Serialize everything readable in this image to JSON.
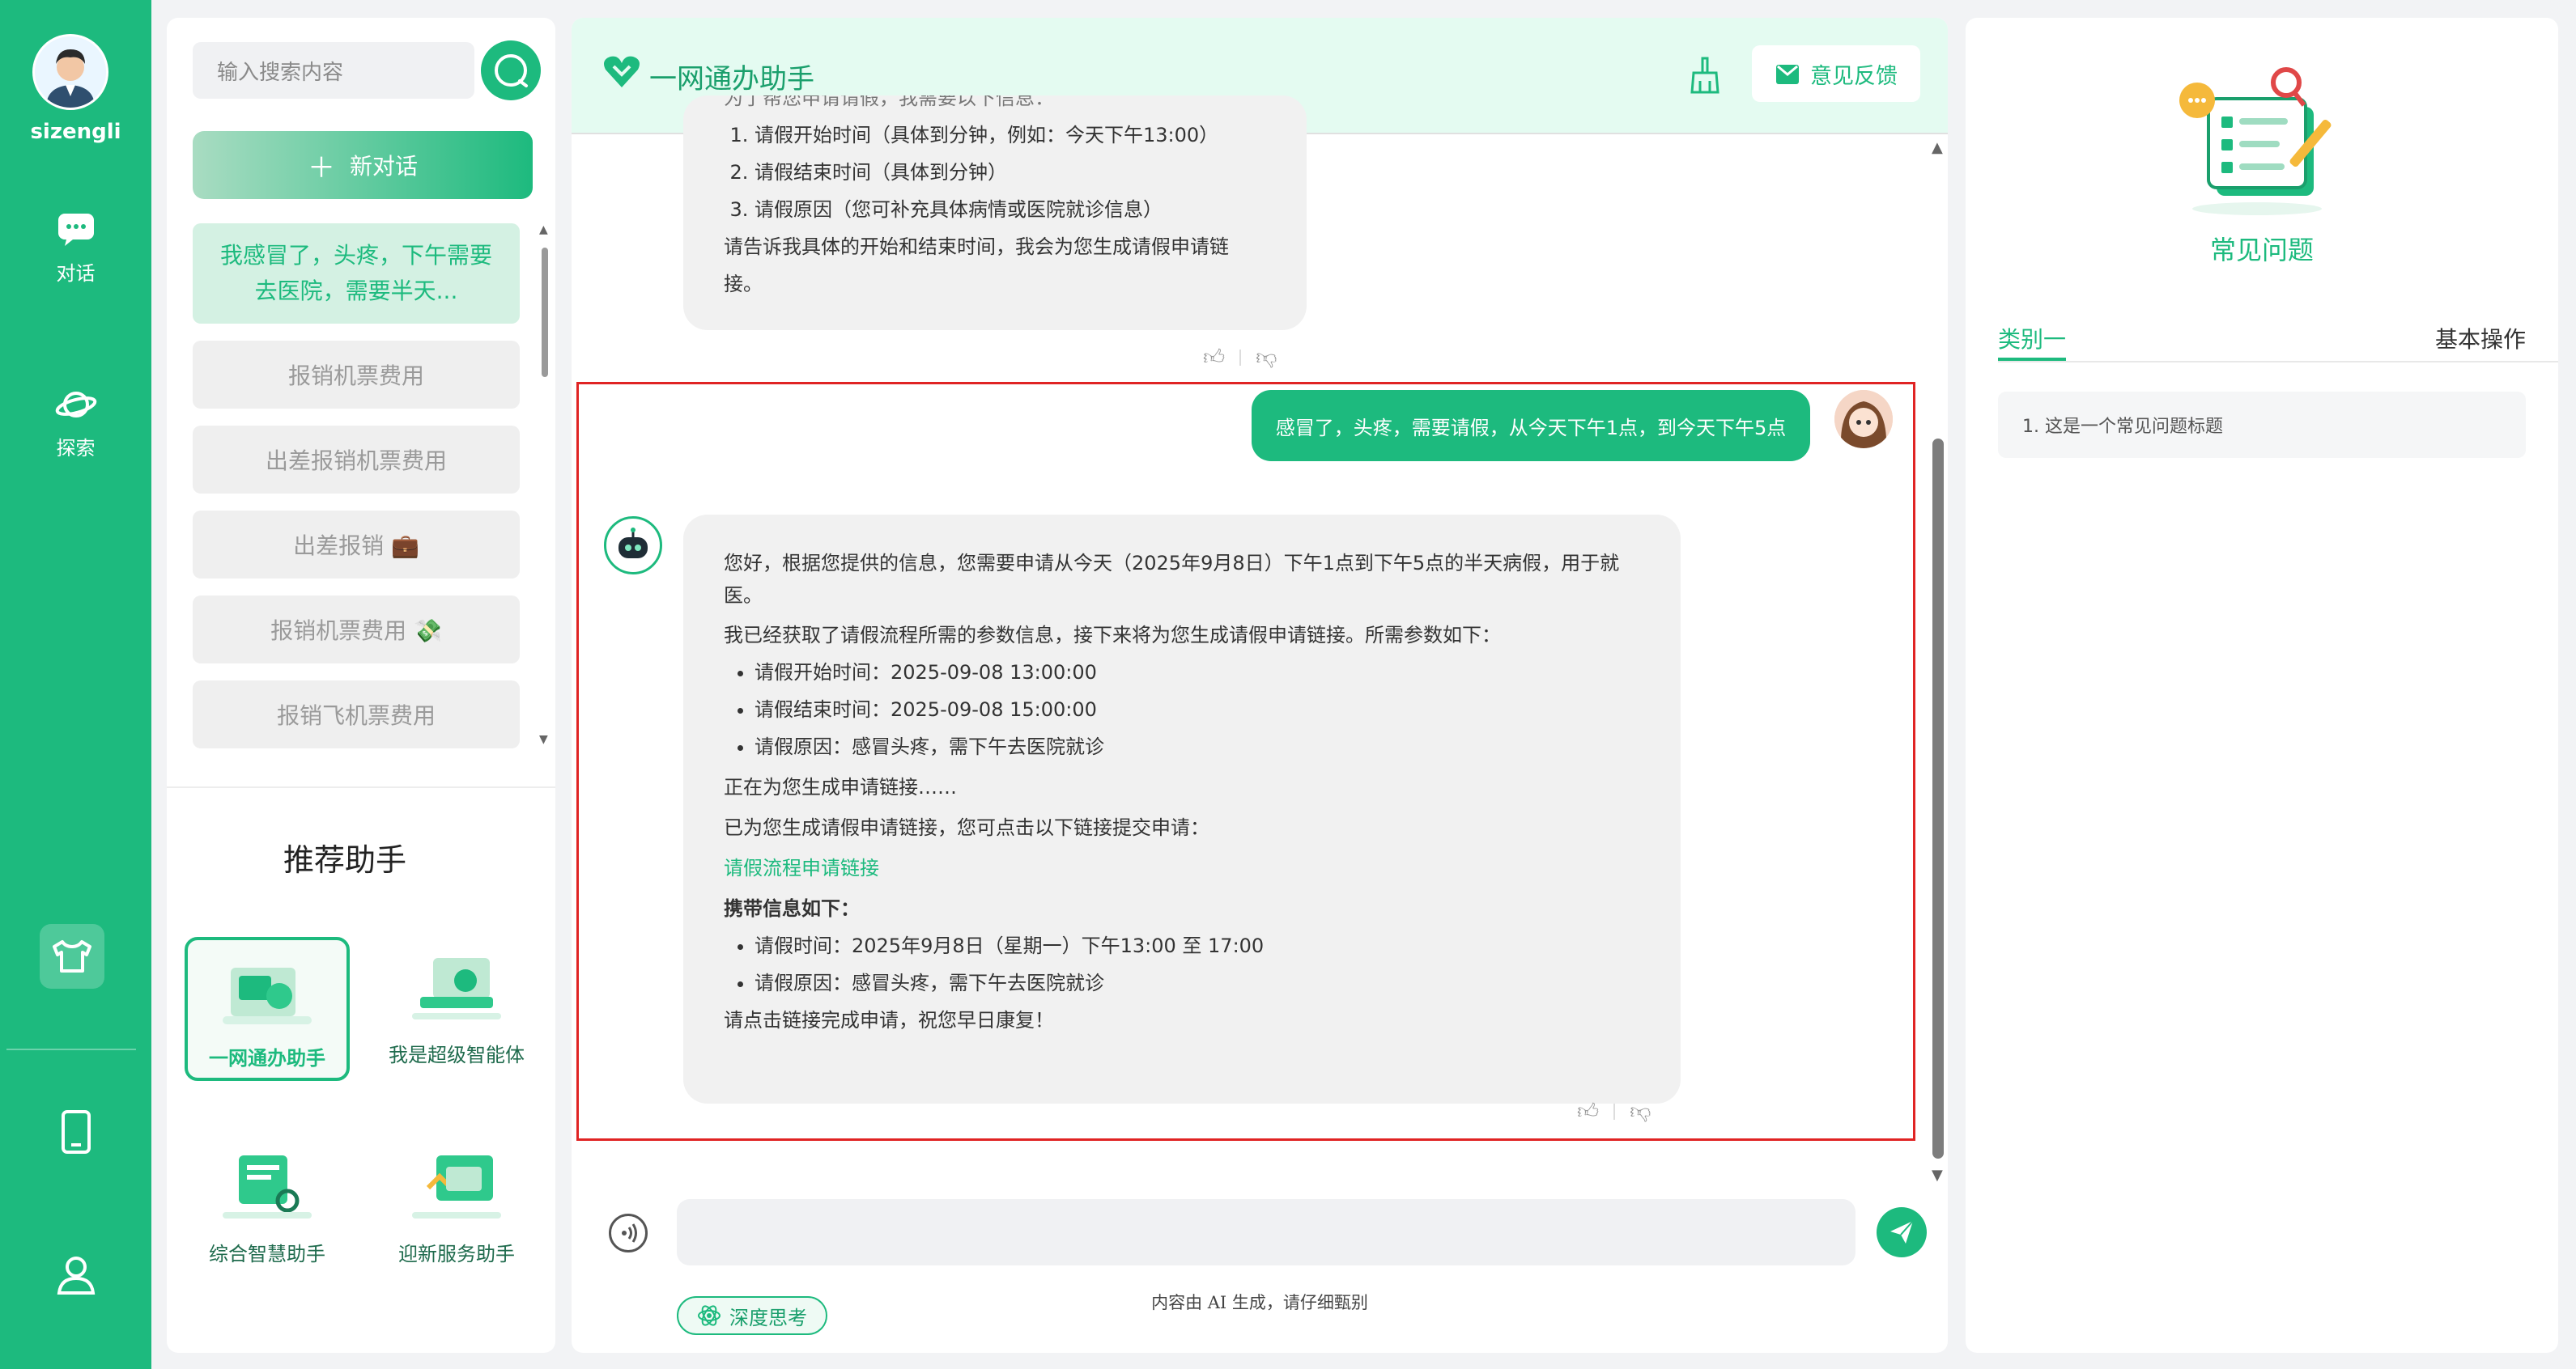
{
  "user": {
    "name": "sizengli"
  },
  "nav": [
    {
      "label": "对话",
      "icon": "chat-icon"
    },
    {
      "label": "探索",
      "icon": "planet-icon"
    }
  ],
  "sidebar": {
    "search_placeholder": "输入搜索内容",
    "new_chat_label": "新对话",
    "conversations": [
      "我感冒了，头疼，下午需要去医院，需要半天...",
      "报销机票费用",
      "出差报销机票费用",
      "出差报销 💼",
      "报销机票费用 💸",
      "报销飞机票费用"
    ],
    "recommend_title": "推荐助手",
    "assistants": [
      "一网通办助手",
      "我是超级智能体",
      "综合智慧助手",
      "迎新服务助手"
    ]
  },
  "chat": {
    "title": "一网通办助手",
    "feedback_label": "意见反馈",
    "prev_bot": {
      "cut_line": "为了帮您申请请假，我需要以下信息：",
      "items": [
        "请假开始时间（具体到分钟，例如：今天下午13:00）",
        "请假结束时间（具体到分钟）",
        "请假原因（您可补充具体病情或医院就诊信息）"
      ],
      "closing": "请告诉我具体的开始和结束时间，我会为您生成请假申请链接。"
    },
    "user_message": "感冒了，头疼，需要请假，从今天下午1点，到今天下午5点",
    "bot_reply": {
      "intro": "您好，根据您提供的信息，您需要申请从今天（2025年9月8日）下午1点到下午5点的半天病假，用于就医。",
      "params_line": "我已经获取了请假流程所需的参数信息，接下来将为您生成请假申请链接。所需参数如下：",
      "params": [
        "请假开始时间：2025-09-08 13:00:00",
        "请假结束时间：2025-09-08 15:00:00",
        "请假原因：感冒头疼，需下午去医院就诊"
      ],
      "generating": "正在为您生成申请链接……",
      "generated": "已为您生成请假申请链接，您可点击以下链接提交申请：",
      "link_text": "请假流程申请链接",
      "carry_title": "携带信息如下：",
      "carry": [
        "请假时间：2025年9月8日（星期一）下午13:00 至 17:00",
        "请假原因：感冒头疼，需下午去医院就诊"
      ],
      "closing": "请点击链接完成申请，祝您早日康复！"
    },
    "input_placeholder": "",
    "deep_think_label": "深度思考",
    "disclaimer": "内容由 AI 生成，请仔细甄别"
  },
  "faq": {
    "heading": "常见问题",
    "tabs": [
      "类别一",
      "基本操作"
    ],
    "items": [
      "1. 这是一个常见问题标题"
    ]
  },
  "colors": {
    "brand": "#1dba7e",
    "highlight_frame": "#e02424"
  }
}
